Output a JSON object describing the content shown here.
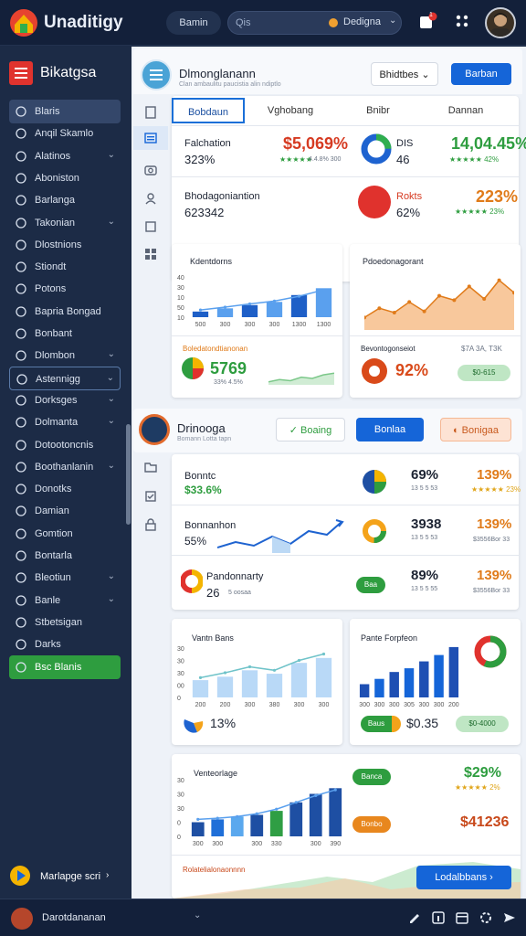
{
  "topbar": {
    "brand": "Unaditigy",
    "button_label": "Bamin",
    "search_placeholder": "Qis",
    "search_select": "Dedigna",
    "notification_badge": "1"
  },
  "sidebar": {
    "title": "Bikatgsa",
    "items": [
      {
        "label": "Blaris",
        "chevron": false,
        "state": "active"
      },
      {
        "label": "Anqil Skamlo",
        "chevron": false,
        "state": ""
      },
      {
        "label": "Alatinos",
        "chevron": true,
        "state": ""
      },
      {
        "label": "Aboniston",
        "chevron": false,
        "state": ""
      },
      {
        "label": "Barlanga",
        "chevron": false,
        "state": ""
      },
      {
        "label": "Takonian",
        "chevron": true,
        "state": ""
      },
      {
        "label": "Dlostnions",
        "chevron": false,
        "state": ""
      },
      {
        "label": "Stiondt",
        "chevron": false,
        "state": ""
      },
      {
        "label": "Potons",
        "chevron": false,
        "state": ""
      },
      {
        "label": "Bapria Bongad",
        "chevron": false,
        "state": ""
      },
      {
        "label": "Bonbant",
        "chevron": false,
        "state": ""
      },
      {
        "label": "Dlombon",
        "chevron": true,
        "state": ""
      },
      {
        "label": "Astennigg",
        "chevron": true,
        "state": "boxed"
      },
      {
        "label": "Dorksges",
        "chevron": true,
        "state": ""
      },
      {
        "label": "Dolmanta",
        "chevron": true,
        "state": ""
      },
      {
        "label": "Dotootoncnis",
        "chevron": false,
        "state": ""
      },
      {
        "label": "Boothanlanin",
        "chevron": true,
        "state": ""
      },
      {
        "label": "Donotks",
        "chevron": false,
        "state": ""
      },
      {
        "label": "Damian",
        "chevron": false,
        "state": ""
      },
      {
        "label": "Gomtion",
        "chevron": false,
        "state": ""
      },
      {
        "label": "Bontarla",
        "chevron": false,
        "state": ""
      },
      {
        "label": "Bleotiun",
        "chevron": true,
        "state": ""
      },
      {
        "label": "Banle",
        "chevron": true,
        "state": ""
      },
      {
        "label": "Stbetsigan",
        "chevron": false,
        "state": ""
      },
      {
        "label": "Darks",
        "chevron": false,
        "state": ""
      },
      {
        "label": "Bsc Blanis",
        "chevron": false,
        "state": "green"
      }
    ],
    "footer_label": "Marlapge scri"
  },
  "bottombar": {
    "user": "Darotdananan"
  },
  "section1": {
    "title": "Dlmonglanann",
    "subtitle": "Clan ambaulitu paucistia alin ndiptlo",
    "dropdown": "Bhidtbes",
    "button": "Barban",
    "tabs": [
      "Bobdaun",
      "Vghobang",
      "Bnibr",
      "Dannan"
    ],
    "metrics": [
      {
        "label": "Falchation",
        "value": "$5,069%",
        "sub": "323%",
        "sub2": "4.4.8% 300",
        "stars": "★★★★★",
        "donut_label": "DIS",
        "donut_value": "46",
        "right_value": "14,04.45%",
        "right_sub": "★★★★★ 42%"
      },
      {
        "label": "Bhodagoniantion",
        "value": "",
        "sub": "623342",
        "donut_label": "Rokts",
        "donut_value": "62%",
        "right_value": "223%",
        "right_sub": "★★★★★ 23%"
      }
    ]
  },
  "chart_panels_1": {
    "left_title": "Kdentdorns",
    "right_title": "Pdoedonagorant",
    "left_stat_title": "Boledatondtianonan",
    "left_stat_value": "5769",
    "left_stat_sub": "33% 4.5%",
    "right_stat_title": "Bevontogonseiot",
    "right_stat_value": "92%",
    "right_stat_corner": "$7A 3A, T3K",
    "right_stat_pill": "$0-615"
  },
  "section2": {
    "title": "Drinooga",
    "subtitle": "Bomann Lotta tapn",
    "buttons": [
      "Boaing",
      "Bonlaa",
      "Bonigaa"
    ],
    "rows": [
      {
        "label": "Bonntc",
        "value": "$33.6%",
        "pct": "69%",
        "pct_sub": "13 5 5 53",
        "right": "139%",
        "right_sub": "★★★★★ 23%"
      },
      {
        "label": "Bonnanhon",
        "value": "55%",
        "pct": "3938",
        "pct_sub": "13 5 5 53",
        "right": "139%",
        "right_sub": "$3556Bor 33"
      },
      {
        "label": "Pandonnarty",
        "value": "26",
        "value_sub": "5 oosaa",
        "pct": "89%",
        "pct_sub": "13 5 5 55",
        "right": "139%",
        "right_sub": "$3556Bor 33",
        "pill": "Baa"
      }
    ]
  },
  "chart_panels_2": {
    "left_title": "Vantn Bans",
    "left_value": "13%",
    "right_title": "Pante Forpfeon",
    "right_pill": "Baus",
    "right_value": "$0.35",
    "right_pill2": "$0-4000"
  },
  "section3": {
    "chart_title": "Venteorlage",
    "pill1": "Banca",
    "value1": "$29%",
    "stars1": "★★★★★ 2%",
    "pill2": "Bonbo",
    "value2": "$41236",
    "footer_title": "Rolatelialonaonnnn",
    "cta": "Lodalbbans"
  },
  "chart_data": [
    {
      "type": "bar",
      "title": "Kdentdorns",
      "categories": [
        "500",
        "300",
        "300",
        "300",
        "1300",
        "1300"
      ],
      "values": [
        14,
        22,
        30,
        38,
        55,
        72
      ],
      "line": [
        18,
        25,
        33,
        40,
        52,
        68
      ],
      "colors": [
        "#1e5fc7",
        "#5aa0ee"
      ],
      "yticks": [
        "40",
        "30",
        "10",
        "50",
        "10"
      ]
    },
    {
      "type": "area",
      "title": "Pdoedonagorant",
      "values": [
        20,
        35,
        28,
        45,
        30,
        55,
        48,
        70,
        50,
        80,
        60
      ],
      "color": "#f39a4a"
    },
    {
      "type": "area",
      "title": "Boledatondtianonan",
      "values": [
        10,
        18,
        14,
        26,
        22,
        34,
        40
      ],
      "color": "#a9ddb0"
    },
    {
      "type": "bar",
      "title": "Vantn Bans",
      "categories": [
        "200",
        "200",
        "300",
        "380",
        "300",
        "300"
      ],
      "values": [
        35,
        42,
        55,
        48,
        70,
        80
      ],
      "line": [
        40,
        50,
        62,
        55,
        75,
        88
      ],
      "colors": [
        "#b9d9f7"
      ],
      "yticks": [
        "30",
        "30",
        "30",
        "00",
        "0"
      ]
    },
    {
      "type": "bar",
      "title": "Pante Forpfeon",
      "categories": [
        "300",
        "300",
        "300",
        "305",
        "300",
        "300",
        "200"
      ],
      "values": [
        25,
        35,
        48,
        55,
        68,
        80,
        95
      ],
      "colors": [
        "#1e4fb3",
        "#1565d8"
      ]
    },
    {
      "type": "bar",
      "title": "Venteorlage",
      "categories": [
        "300",
        "300",
        "300",
        "330",
        "300",
        "390"
      ],
      "values": [
        25,
        30,
        35,
        38,
        45,
        60,
        75,
        85
      ],
      "line": [
        30,
        32,
        35,
        40,
        48,
        60,
        72,
        82
      ],
      "colors": [
        "#1e4fa3",
        "#1f6fd8",
        "#5aa8ee",
        "#1e4fa3",
        "#2f9e44",
        "#1e4fa3",
        "#1e4fa3",
        "#1e4fa3"
      ],
      "yticks": [
        "30",
        "30",
        "30",
        "0",
        "0"
      ]
    }
  ]
}
